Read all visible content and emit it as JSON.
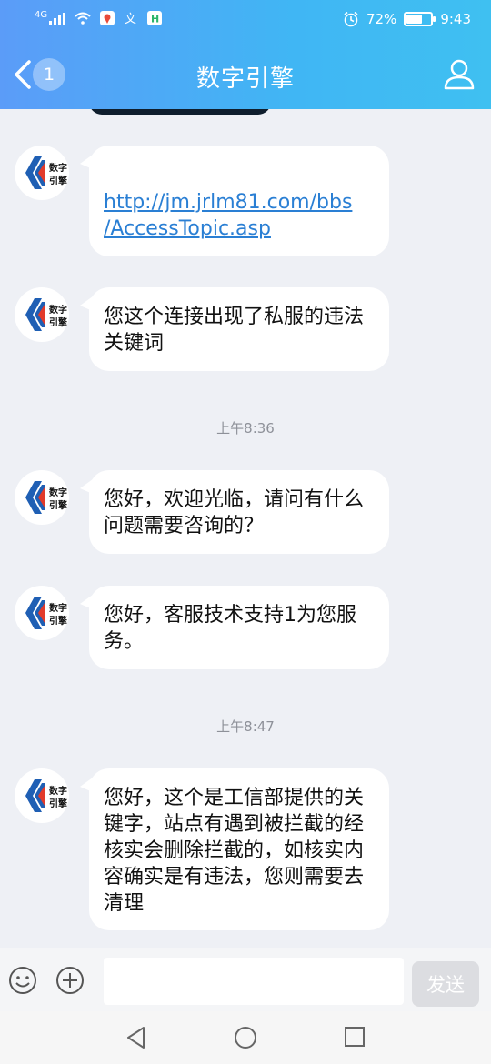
{
  "status_bar": {
    "network": "4G",
    "alarm": "alarm-icon",
    "battery_percent": "72%",
    "battery_level": 0.72,
    "time": "9:43"
  },
  "header": {
    "back_badge": "1",
    "title": "数字引擎"
  },
  "avatar": {
    "text_line1": "数字",
    "text_line2": "引擎",
    "colors": {
      "blue": "#1f5fb4",
      "red": "#e23a2a"
    }
  },
  "messages": [
    {
      "link_line1": "http://jm.jrlm81.com/bbs",
      "link_line2": "/AccessTopic.asp"
    },
    {
      "text": "您这个连接出现了私服的违法关键词"
    },
    {
      "timestamp": "上午8:36"
    },
    {
      "text": "您好，欢迎光临，请问有什么问题需要咨询的？"
    },
    {
      "text": "您好，客服技术支持1为您服务。"
    },
    {
      "timestamp": "上午8:47"
    },
    {
      "text": "您好，这个是工信部提供的关键字，站点有遇到被拦截的经核实会删除拦截的，如核实内容确实是有违法，您则需要去清理"
    }
  ],
  "input_bar": {
    "input_value": "",
    "send_label": "发送"
  },
  "colors": {
    "header_start": "#5b9cf8",
    "header_end": "#3fc0f1",
    "link": "#2a7fd4",
    "background": "#eef0f5"
  }
}
